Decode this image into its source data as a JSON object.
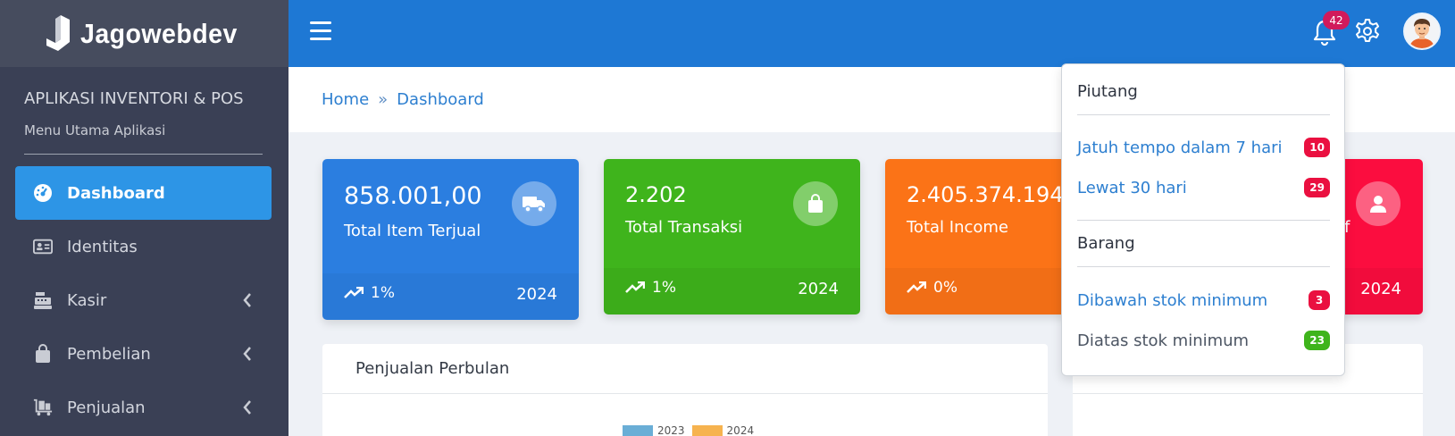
{
  "brand": {
    "name": "Jagowebdev"
  },
  "sidebar": {
    "app_title": "APLIKASI INVENTORI & POS",
    "subtitle": "Menu Utama Aplikasi",
    "items": [
      {
        "label": "Dashboard",
        "icon": "gauge-icon",
        "active": true
      },
      {
        "label": "Identitas",
        "icon": "id-card-icon"
      },
      {
        "label": "Kasir",
        "icon": "cash-register-icon",
        "has_submenu": true
      },
      {
        "label": "Pembelian",
        "icon": "shopping-bag-icon",
        "has_submenu": true
      },
      {
        "label": "Penjualan",
        "icon": "cart-flatbed-icon",
        "has_submenu": true
      }
    ]
  },
  "topbar": {
    "notification_count": "42"
  },
  "breadcrumb": {
    "home": "Home",
    "current": "Dashboard"
  },
  "cards": [
    {
      "value": "858.001,00",
      "label": "Total Item Terjual",
      "trend": "1%",
      "year": "2024",
      "color": "#2b7ee0",
      "icon": "truck-icon"
    },
    {
      "value": "2.202",
      "label": "Total Transaksi",
      "trend": "1%",
      "year": "2024",
      "color": "#3fb41c",
      "icon": "shopping-bag-icon"
    },
    {
      "value": "2.405.374.194",
      "label": "Total Income",
      "trend": "0%",
      "year": "2024",
      "color": "#fb7317",
      "icon": ""
    },
    {
      "label_fragment": "if",
      "year": "2024",
      "color": "#fb0d3f",
      "icon": "user-icon"
    }
  ],
  "panels": {
    "left_title": "Penjualan Perbulan",
    "legend": [
      {
        "label": "2023",
        "color": "#6aaed6"
      },
      {
        "label": "2024",
        "color": "#f6b34f"
      }
    ]
  },
  "dropdown": {
    "section1": "Piutang",
    "items1": [
      {
        "label": "Jatuh tempo dalam 7 hari",
        "badge": "10",
        "badge_color": "#ea1040"
      },
      {
        "label": "Lewat 30 hari",
        "badge": "29",
        "badge_color": "#ea1040"
      }
    ],
    "section2": "Barang",
    "items2": [
      {
        "label": "Dibawah stok minimum",
        "badge": "3",
        "badge_color": "#ea1040"
      },
      {
        "label": "Diatas stok minimum",
        "badge": "23",
        "badge_color": "#3fb41c"
      }
    ]
  }
}
